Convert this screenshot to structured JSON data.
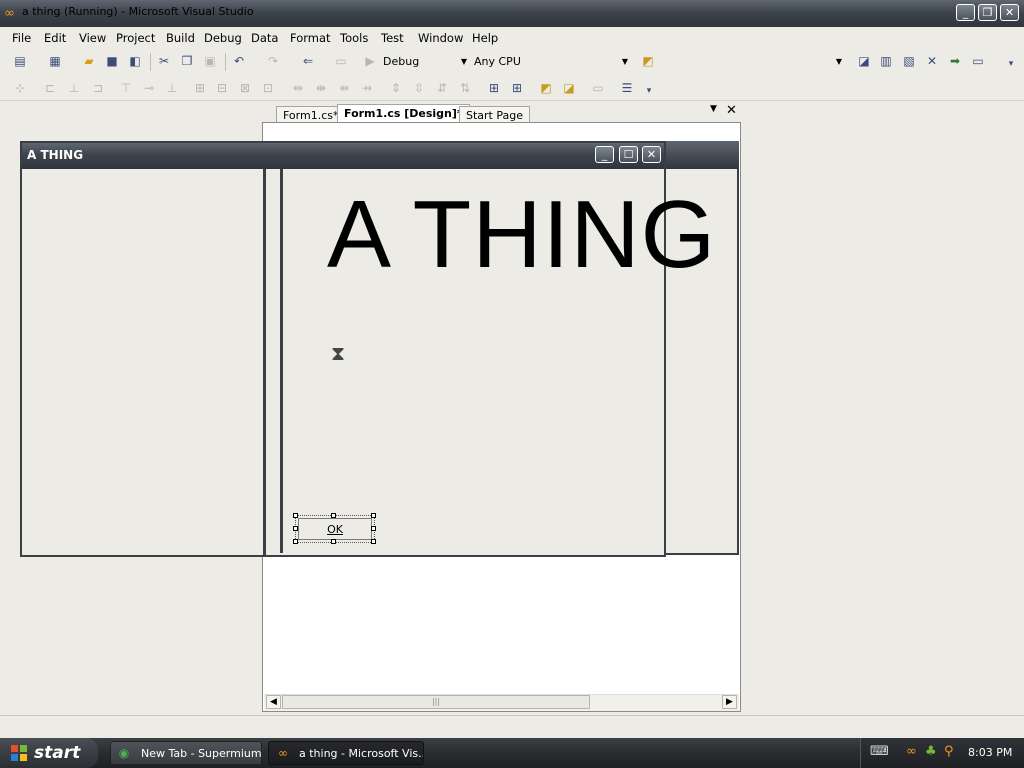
{
  "window": {
    "title": "a thing (Running) - Microsoft Visual Studio",
    "title_icon": "vs-infinity-icon",
    "controls": [
      "_",
      "❐",
      "✕"
    ]
  },
  "menu": {
    "items": [
      "File",
      "Edit",
      "View",
      "Project",
      "Build",
      "Debug",
      "Data",
      "Format",
      "Tools",
      "Test",
      "Window",
      "Help"
    ]
  },
  "toolbar": {
    "solution_config": "Debug",
    "solution_platform": "Any CPU",
    "find_combo": ""
  },
  "tabs": [
    {
      "label": "Form1.cs*",
      "active": false
    },
    {
      "label": "Form1.cs [Design]*",
      "active": true
    },
    {
      "label": "Start Page",
      "active": false
    }
  ],
  "designer": {
    "big_label": "A THING",
    "ok_button": "OK"
  },
  "app_window": {
    "title": "A THING",
    "controls": [
      "_",
      "☐",
      "✕"
    ]
  },
  "taskbar": {
    "start_label": "start",
    "tasks": [
      {
        "label": "New Tab - Supermium",
        "icon": "browser-icon"
      },
      {
        "label": "a thing - Microsoft Vis...",
        "icon": "vs-icon"
      }
    ],
    "clock": "8:03 PM"
  },
  "colors": {
    "titlebar": "#3d444c",
    "workspace": "#ecebe6",
    "designer_bg": "#ffffff"
  }
}
